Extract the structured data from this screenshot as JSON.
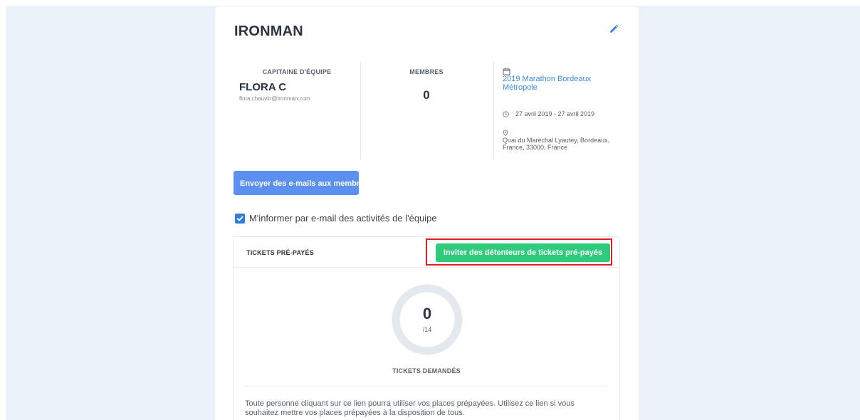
{
  "team": {
    "name": "IRONMAN"
  },
  "captain": {
    "label": "CAPITAINE D'ÉQUIPE",
    "name": "FLORA C",
    "email": "flora.chauvin@ironman.com"
  },
  "members": {
    "label": "MEMBRES",
    "count": "0"
  },
  "event": {
    "name": "2019 Marathon Bordeaux Métropole",
    "dates": "27 avril 2019 - 27 avril 2019",
    "address": "Quai du Maréchal Lyautey, Bordeaux, France, 33000, France"
  },
  "actions": {
    "email_members_label": "Envoyer des e-mails aux membres",
    "notify_label": "M'informer par e-mail des activités de l'équipe",
    "notify_checked": true
  },
  "tickets": {
    "title": "TICKETS PRÉ-PAYÉS",
    "invite_label": "Inviter des détenteurs de tickets pré-payés",
    "requested": "0",
    "total": "/14",
    "requested_fraction": 0,
    "requested_label": "TICKETS DEMANDÉS",
    "description": "Toute personne cliquant sur ce lien pourra utiliser vos places prépayées. Utilisez ce lien si vous souhaitez mettre vos places prépayées à la disposition de tous."
  },
  "colors": {
    "page_background": "#eaf1f8",
    "primary_button": "#5b8ff0",
    "invite_button": "#2ecb7b",
    "highlight_border": "#e31b23",
    "link": "#3a8ee6",
    "checkbox": "#2f7ed8",
    "donut_track": "#e3e9ee"
  },
  "icons": {
    "edit": "pencil-icon",
    "calendar": "calendar-icon",
    "clock": "clock-icon",
    "location": "map-pin-icon",
    "check": "checkmark-icon"
  }
}
